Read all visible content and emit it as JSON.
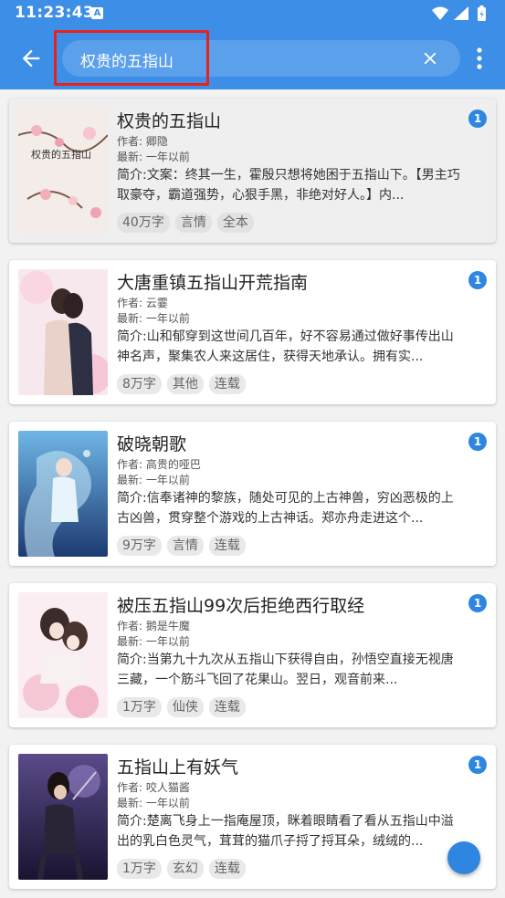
{
  "status_bar": {
    "time": "11:23:43",
    "notification_glyph": "A"
  },
  "search": {
    "query": "权贵的五指山"
  },
  "colors": {
    "app_bar": "#3d8ee6",
    "highlight": "#e8201e",
    "badge": "#2e86e0"
  },
  "results": [
    {
      "title": "权贵的五指山",
      "author": "作者: 卿隐",
      "latest": "最新: 一年以前",
      "intro": "简介:文案：终其一生，霍殷只想将她困于五指山下。【男主巧取豪夺，霸道强势，心狠手黑，非绝对好人。】内...",
      "tags": [
        "40万字",
        "言情",
        "全本"
      ],
      "badge": "1",
      "cover_text": "权贵的五指山",
      "cover_icon": "plum-blossom-cover"
    },
    {
      "title": "大唐重镇五指山开荒指南",
      "author": "作者: 云霎",
      "latest": "最新: 一年以前",
      "intro": "简介:山和郁穿到这世间几百年，好不容易通过做好事传出山神名声，聚集农人来这居住，获得天地承认。拥有实...",
      "tags": [
        "8万字",
        "其他",
        "连载"
      ],
      "badge": "1",
      "cover_icon": "couple-portrait-cover"
    },
    {
      "title": "破晓朝歌",
      "author": "作者: 高贵的哑巴",
      "latest": "最新: 一年以前",
      "intro": "简介:信奉诸神的黎族，随处可见的上古神兽，穷凶恶极的上古凶兽，贯穿整个游戏的上古神话。郑亦舟走进这个...",
      "tags": [
        "9万字",
        "言情",
        "连载"
      ],
      "badge": "1",
      "cover_icon": "fantasy-goddess-cover"
    },
    {
      "title": "被压五指山99次后拒绝西行取经",
      "author": "作者: 鹅是牛魔",
      "latest": "最新: 一年以前",
      "intro": "简介:当第九十九次从五指山下获得自由，孙悟空直接无视唐三藏，一个筋斗飞回了花果山。翌日，观音前来...",
      "tags": [
        "1万字",
        "仙侠",
        "连载"
      ],
      "badge": "1",
      "cover_icon": "romance-couple-cover"
    },
    {
      "title": "五指山上有妖气",
      "author": "作者: 咬人猫酱",
      "latest": "最新: 一年以前",
      "intro": "简介:楚离飞身上一指庵屋顶，眯着眼睛看了看从五指山中溢出的乳白色灵气，茸茸的猫爪子捋了捋耳朵，绒绒的...",
      "tags": [
        "1万字",
        "玄幻",
        "连载"
      ],
      "badge": "1",
      "cover_icon": "warrior-woman-cover"
    }
  ]
}
